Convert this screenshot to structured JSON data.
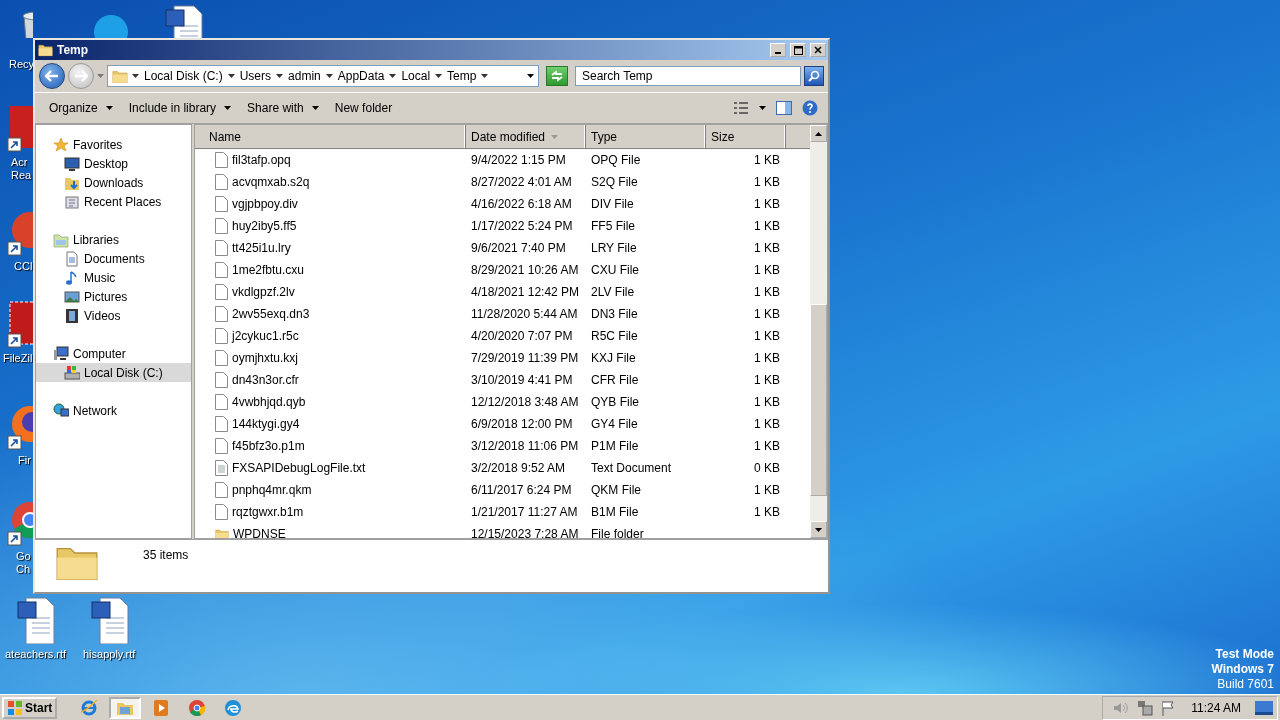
{
  "desktop": {
    "icons": [
      {
        "kind": "recycle",
        "label": [
          "Recy"
        ]
      },
      {
        "kind": "skype"
      },
      {
        "kind": "word"
      },
      {
        "kind": "acrobat",
        "label": [
          "Acr",
          "Rea"
        ]
      },
      {
        "kind": "ccleaner",
        "label": [
          "CCl"
        ]
      },
      {
        "kind": "filezilla",
        "label": [
          "FileZil"
        ]
      },
      {
        "kind": "firefox",
        "label": [
          "Fir"
        ]
      },
      {
        "kind": "chrome",
        "label": [
          "Go",
          "Ch"
        ]
      },
      {
        "kind": "word",
        "label": [
          "ateachers.rtf"
        ]
      },
      {
        "kind": "word",
        "label": [
          "hisapply.rtf"
        ]
      }
    ],
    "system_text": [
      {
        "text": "Test Mode",
        "bold": true
      },
      {
        "text": "Windows 7",
        "bold": true
      },
      {
        "text": "Build 7601",
        "bold": false
      }
    ]
  },
  "window": {
    "title": "Temp",
    "breadcrumb": [
      "Local Disk (C:)",
      "Users",
      "admin",
      "AppData",
      "Local",
      "Temp"
    ],
    "search": {
      "placeholder": "Search Temp"
    },
    "toolbar": [
      {
        "label": "Organize",
        "menu": true
      },
      {
        "label": "Include in library",
        "menu": true
      },
      {
        "label": "Share with",
        "menu": true
      },
      {
        "label": "New folder",
        "menu": false
      }
    ],
    "sidebar": [
      {
        "label": "Favorites",
        "kind": "star",
        "selected": false,
        "children": [
          {
            "label": "Desktop",
            "kind": "desktop",
            "selected": false
          },
          {
            "label": "Downloads",
            "kind": "downloads",
            "selected": false
          },
          {
            "label": "Recent Places",
            "kind": "recent",
            "selected": false
          }
        ]
      },
      {
        "label": "Libraries",
        "kind": "library",
        "selected": false,
        "children": [
          {
            "label": "Documents",
            "kind": "documents",
            "selected": false
          },
          {
            "label": "Music",
            "kind": "music",
            "selected": false
          },
          {
            "label": "Pictures",
            "kind": "pictures",
            "selected": false
          },
          {
            "label": "Videos",
            "kind": "videos",
            "selected": false
          }
        ]
      },
      {
        "label": "Computer",
        "kind": "computer",
        "selected": false,
        "children": [
          {
            "label": "Local Disk (C:)",
            "kind": "drive",
            "selected": true
          }
        ]
      },
      {
        "label": "Network",
        "kind": "network",
        "selected": false
      }
    ],
    "table": {
      "columns": [
        {
          "label": "Name",
          "sorted": false
        },
        {
          "label": "Date modified",
          "sorted": true
        },
        {
          "label": "Type",
          "sorted": false
        },
        {
          "label": "Size",
          "sorted": false
        }
      ],
      "rows": [
        {
          "kind": "file",
          "name": "fil3tafp.opq",
          "date": "9/4/2022 1:15 PM",
          "type": "OPQ File",
          "size": "1 KB"
        },
        {
          "kind": "file",
          "name": "acvqmxab.s2q",
          "date": "8/27/2022 4:01 AM",
          "type": "S2Q File",
          "size": "1 KB"
        },
        {
          "kind": "file",
          "name": "vgjpbpoy.div",
          "date": "4/16/2022 6:18 AM",
          "type": "DIV File",
          "size": "1 KB"
        },
        {
          "kind": "file",
          "name": "huy2iby5.ff5",
          "date": "1/17/2022 5:24 PM",
          "type": "FF5 File",
          "size": "1 KB"
        },
        {
          "kind": "file",
          "name": "tt425i1u.lry",
          "date": "9/6/2021 7:40 PM",
          "type": "LRY File",
          "size": "1 KB"
        },
        {
          "kind": "file",
          "name": "1me2fbtu.cxu",
          "date": "8/29/2021 10:26 AM",
          "type": "CXU File",
          "size": "1 KB"
        },
        {
          "kind": "file",
          "name": "vkdlgpzf.2lv",
          "date": "4/18/2021 12:42 PM",
          "type": "2LV File",
          "size": "1 KB"
        },
        {
          "kind": "file",
          "name": "2wv55exq.dn3",
          "date": "11/28/2020 5:44 AM",
          "type": "DN3 File",
          "size": "1 KB"
        },
        {
          "kind": "file",
          "name": "j2cykuc1.r5c",
          "date": "4/20/2020 7:07 PM",
          "type": "R5C File",
          "size": "1 KB"
        },
        {
          "kind": "file",
          "name": "oymjhxtu.kxj",
          "date": "7/29/2019 11:39 PM",
          "type": "KXJ File",
          "size": "1 KB"
        },
        {
          "kind": "file",
          "name": "dn43n3or.cfr",
          "date": "3/10/2019 4:41 PM",
          "type": "CFR File",
          "size": "1 KB"
        },
        {
          "kind": "file",
          "name": "4vwbhjqd.qyb",
          "date": "12/12/2018 3:48 AM",
          "type": "QYB File",
          "size": "1 KB"
        },
        {
          "kind": "file",
          "name": "144ktygi.gy4",
          "date": "6/9/2018 12:00 PM",
          "type": "GY4 File",
          "size": "1 KB"
        },
        {
          "kind": "file",
          "name": "f45bfz3o.p1m",
          "date": "3/12/2018 11:06 PM",
          "type": "P1M File",
          "size": "1 KB"
        },
        {
          "kind": "text",
          "name": "FXSAPIDebugLogFile.txt",
          "date": "3/2/2018 9:52 AM",
          "type": "Text Document",
          "size": "0 KB"
        },
        {
          "kind": "file",
          "name": "pnphq4mr.qkm",
          "date": "6/11/2017 6:24 PM",
          "type": "QKM File",
          "size": "1 KB"
        },
        {
          "kind": "file",
          "name": "rqztgwxr.b1m",
          "date": "1/21/2017 11:27 AM",
          "type": "B1M File",
          "size": "1 KB"
        },
        {
          "kind": "folder",
          "name": "WPDNSE",
          "date": "12/15/2023 7:28 AM",
          "type": "File folder"
        }
      ]
    },
    "details": {
      "count": "35 items"
    }
  },
  "taskbar": {
    "start": "Start",
    "apps": [
      {
        "kind": "ie",
        "selected": false
      },
      {
        "kind": "explorer",
        "selected": true
      },
      {
        "kind": "media",
        "selected": false
      },
      {
        "kind": "chrome",
        "selected": false
      },
      {
        "kind": "edge",
        "selected": false
      }
    ],
    "clock": "11:24 AM"
  }
}
